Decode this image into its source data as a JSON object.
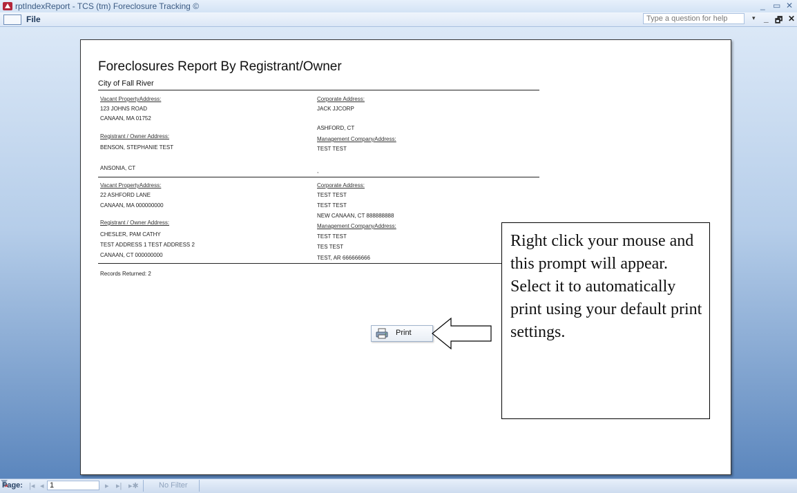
{
  "window": {
    "title": "rptIndexReport - TCS (tm) Foreclosure Tracking ©",
    "minimize": "_",
    "restore": "▭",
    "close": "✕"
  },
  "menubar": {
    "file": "File",
    "help_placeholder": "Type a question for help",
    "help_dropdown": "▾",
    "mdi_min": "_",
    "mdi_restore": "🗗",
    "mdi_close": "✕"
  },
  "report": {
    "title": "Foreclosures Report By Registrant/Owner",
    "subtitle": "City of Fall River",
    "records": [
      {
        "vacant_label": "Vacant PropertyAddress:",
        "vacant_line1": " 123 JOHNS ROAD",
        "vacant_line2": "CANAAN, MA 01752",
        "registrant_label": "Registrant / Owner Address:",
        "registrant_line1": "BENSON, STEPHANIE TEST",
        "registrant_line2": "",
        "registrant_line3": "ANSONIA, CT",
        "corporate_label": "Corporate Address:",
        "corporate_line1": "JACK JJCORP",
        "corporate_line2": "",
        "corporate_line3": "ASHFORD, CT",
        "management_label": "Management CompanyAddress:",
        "management_line1": "TEST TEST",
        "management_line2": "",
        "management_line3": ","
      },
      {
        "vacant_label": "Vacant PropertyAddress:",
        "vacant_line1": "22 ASHFORD LANE",
        "vacant_line2": "CANAAN, MA 000000000",
        "registrant_label": "Registrant / Owner Address:",
        "registrant_line1": "CHESLER, PAM CATHY",
        "registrant_line2": "TEST ADDRESS 1 TEST ADDRESS 2",
        "registrant_line3": "CANAAN, CT 000000000",
        "corporate_label": "Corporate Address:",
        "corporate_line1": "TEST TEST",
        "corporate_line2": "TEST TEST",
        "corporate_line3": "NEW CANAAN, CT 888888888",
        "management_label": "Management CompanyAddress:",
        "management_line1": "TEST TEST",
        "management_line2": "TES TEST",
        "management_line3": "TEST, AR 666666666"
      }
    ],
    "records_returned": "Records Returned:  2"
  },
  "context_menu": {
    "print_label": "Print"
  },
  "callout": {
    "text": "Right click your mouse and this prompt will appear. Select it to automatically print using your default print settings."
  },
  "statusbar": {
    "page_label": "Page:",
    "first": "|◂",
    "prev": "◂",
    "page_value": "1",
    "next": "▸",
    "last": "▸|",
    "new": "▸✱",
    "filter_label": "No Filter"
  }
}
